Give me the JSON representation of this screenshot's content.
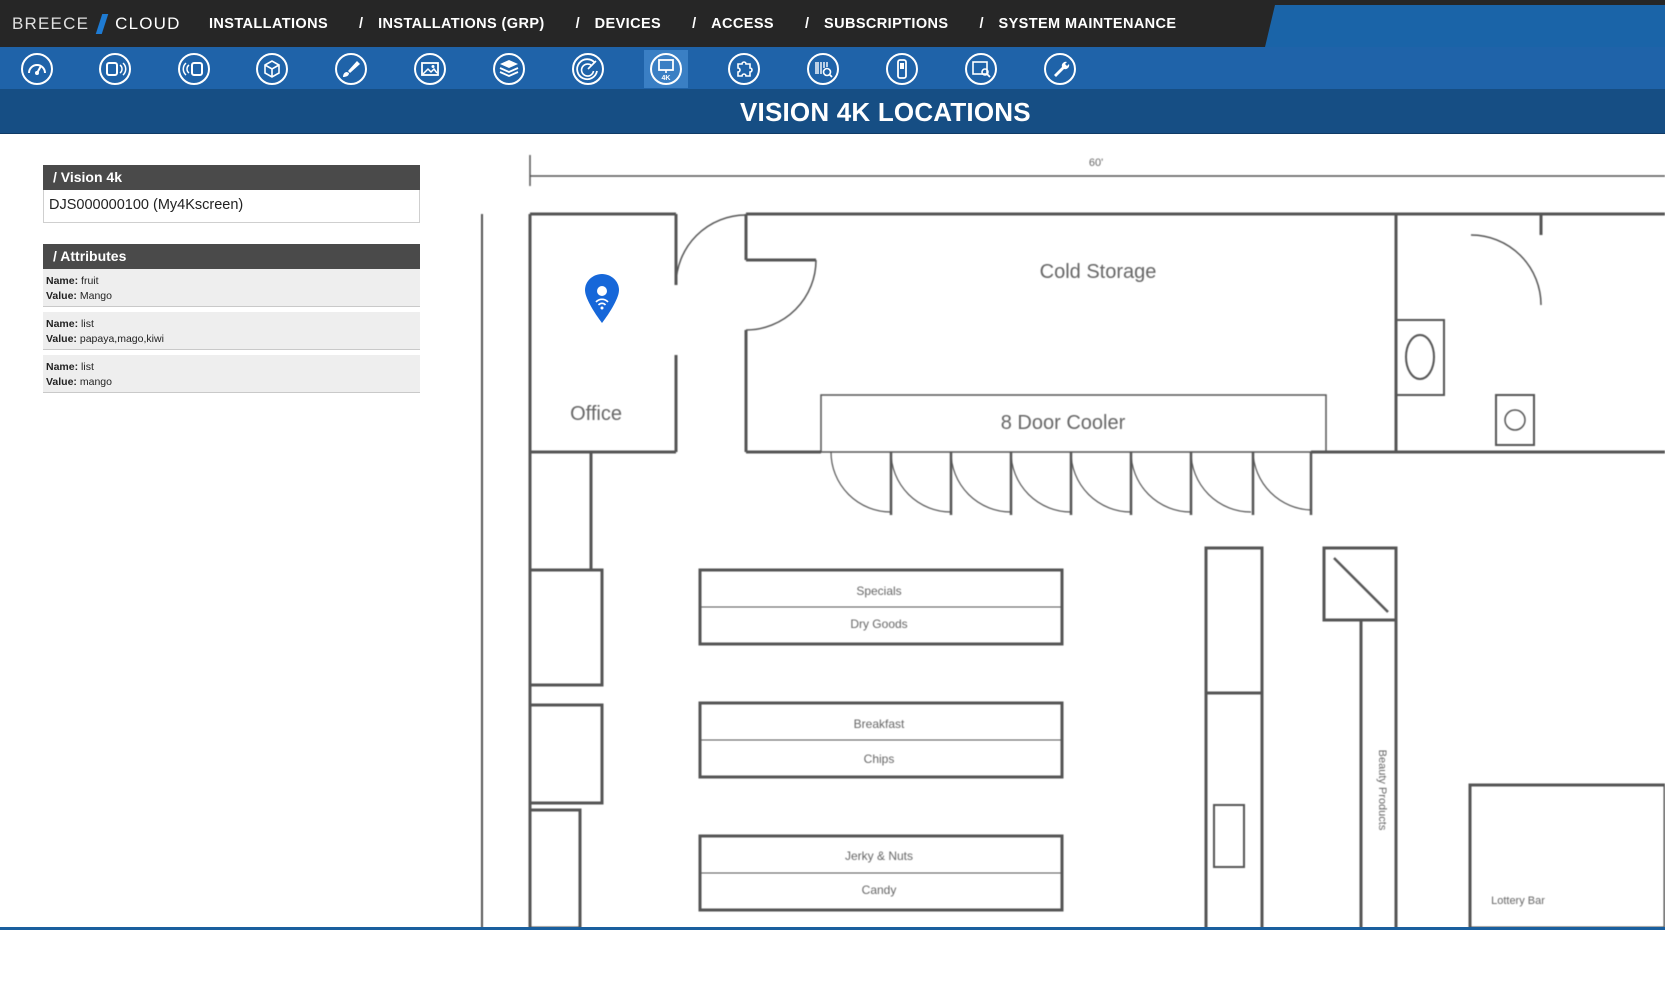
{
  "brand": {
    "left": "BREECE",
    "right": "CLOUD"
  },
  "nav": [
    "INSTALLATIONS",
    "INSTALLATIONS (GRP)",
    "DEVICES",
    "ACCESS",
    "SUBSCRIPTIONS",
    "SYSTEM MAINTENANCE"
  ],
  "iconbar": [
    {
      "name": "dashboard-icon",
      "active": false
    },
    {
      "name": "beacon-icon",
      "active": false
    },
    {
      "name": "broadcast-icon",
      "active": false
    },
    {
      "name": "box-icon",
      "active": false
    },
    {
      "name": "brush-icon",
      "active": false
    },
    {
      "name": "image-gallery-icon",
      "active": false
    },
    {
      "name": "layers-icon",
      "active": false
    },
    {
      "name": "radar-icon",
      "active": false
    },
    {
      "name": "vision-4k-icon",
      "active": true
    },
    {
      "name": "puzzle-icon",
      "active": false
    },
    {
      "name": "scanner-icon",
      "active": false
    },
    {
      "name": "handheld-device-icon",
      "active": false
    },
    {
      "name": "screen-search-icon",
      "active": false
    },
    {
      "name": "wrench-icon",
      "active": false
    }
  ],
  "page_title": "VISION 4K LOCATIONS",
  "vision_panel": {
    "header": "/ Vision 4k",
    "device": "DJS000000100 (My4Kscreen)"
  },
  "attributes_panel": {
    "header": "/ Attributes",
    "name_label": "Name:",
    "value_label": "Value:",
    "items": [
      {
        "name": "fruit",
        "value": "Mango"
      },
      {
        "name": "list",
        "value": "papaya,mago,kiwi"
      },
      {
        "name": "list",
        "value": "mango"
      }
    ]
  },
  "floorplan": {
    "labels": {
      "office": "Office",
      "cold_storage": "Cold Storage",
      "door_cooler": "8 Door Cooler",
      "specials": "Specials",
      "dry_goods": "Dry Goods",
      "breakfast": "Breakfast",
      "chips": "Chips",
      "jerky_nuts": "Jerky & Nuts",
      "candy": "Candy",
      "dimension": "60'",
      "beauty_products": "Beauty Products",
      "lottery": "Lottery Bar"
    }
  }
}
